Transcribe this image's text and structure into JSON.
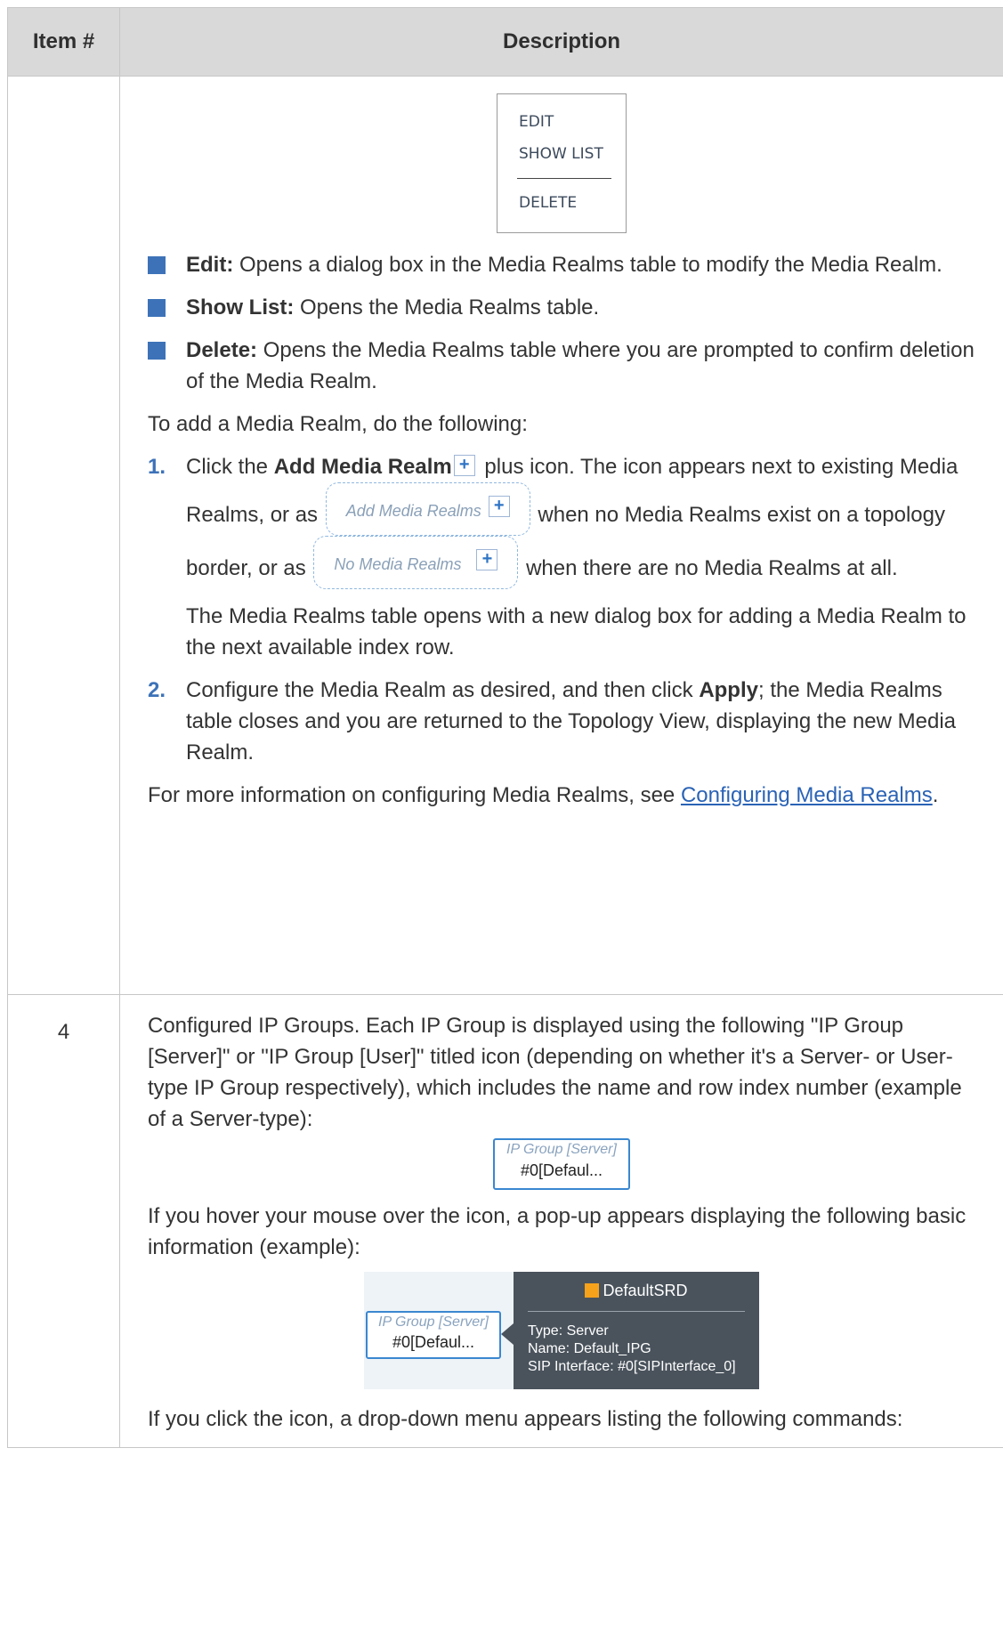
{
  "table": {
    "header": {
      "col1": "Item #",
      "col2": "Description"
    }
  },
  "row1": {
    "menu": {
      "items": [
        "EDIT",
        "SHOW LIST",
        "DELETE"
      ]
    },
    "bullets": [
      {
        "term": "Edit:",
        "text": " Opens a dialog box in the Media Realms table to modify the Media Realm."
      },
      {
        "term": "Show List:",
        "text": " Opens the Media Realms table."
      },
      {
        "term": "Delete:",
        "text": " Opens the Media Realms table where you are prompted to confirm deletion of the Media Realm."
      }
    ],
    "intro": "To add a Media Realm, do the following:",
    "step1": {
      "num": "1.",
      "a": "Click the ",
      "bold": "Add Media Realm",
      "b": " plus icon. The icon appears next to existing Media Realms, or as ",
      "pill1": "Add Media Realms",
      "c": " when no Media Realms exist on a topology border, or as ",
      "pill2": "No Media Realms",
      "d": " when there are no Media Realms at all.",
      "follow": "The Media Realms table opens with a new dialog box for adding a Media Realm to the next available index row."
    },
    "step2": {
      "num": "2.",
      "a": "Configure the Media Realm as desired, and then click ",
      "bold": "Apply",
      "b": "; the Media Realms table closes and you are returned to the Topology View, displaying the new Media Realm."
    },
    "more": {
      "text": "For more information on configuring Media Realms, see ",
      "link": "Configuring Media Realms",
      "end": "."
    },
    "plus": "+"
  },
  "row2": {
    "item_num": "4",
    "para1": "Configured IP Groups. Each IP Group is displayed using the following \"IP Group [Server]\" or \"IP Group [User]\" titled icon (depending on whether it's a Server- or User-type IP Group respectively), which includes the name and row index number (example of a Server-type):",
    "icon": {
      "title": "IP Group [Server]",
      "value": "#0[Defaul..."
    },
    "para2": "If you hover your mouse over the icon, a pop-up appears displaying the following basic information (example):",
    "popup": {
      "heading": "DefaultSRD",
      "swatch_color": "#f7a21b",
      "lines": [
        "Type: Server",
        "Name: Default_IPG",
        "SIP Interface: #0[SIPInterface_0]"
      ]
    },
    "para3": "If you click the icon, a drop-down menu appears listing the following commands:"
  }
}
